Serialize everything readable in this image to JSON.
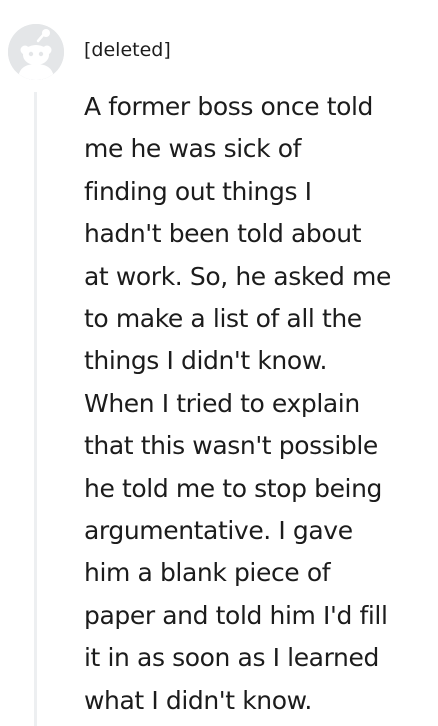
{
  "comment": {
    "author": "[deleted]",
    "avatar_icon": "snoo-avatar-icon",
    "body_lines": [
      "A former boss once told",
      "me he was sick of",
      "finding out things I",
      "hadn't been told about",
      "at work. So, he asked me",
      "to make a list of all the",
      "things I didn't know.",
      "When I tried to explain",
      "that this wasn't possible",
      "he told me to stop being",
      "argumentative. I gave",
      "him a blank piece of",
      "paper and told him I'd fill",
      "it in as soon as I learned",
      "what I didn't know."
    ]
  },
  "colors": {
    "avatar_bg": "#e4e6e8",
    "avatar_fg": "#ffffff",
    "thread_line": "#edeff1",
    "text": "#1c1c1c"
  }
}
